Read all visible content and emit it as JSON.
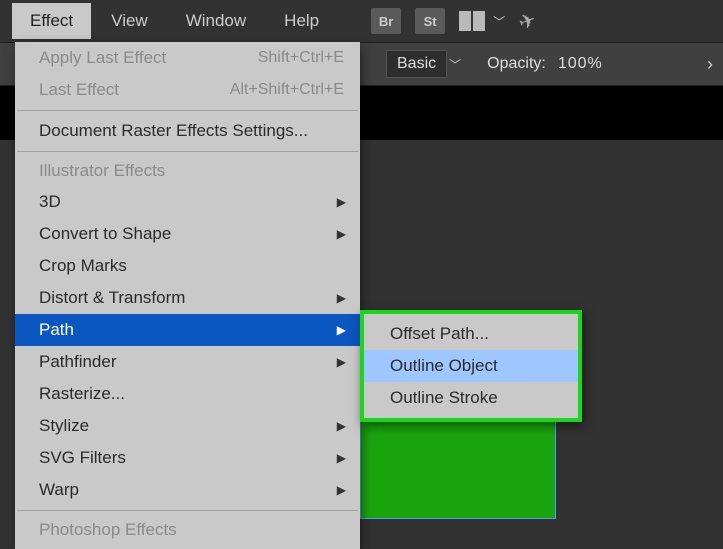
{
  "menubar": {
    "items": [
      "Effect",
      "View",
      "Window",
      "Help"
    ],
    "open_index": 0,
    "icons": {
      "bridge": "Br",
      "stock": "St"
    }
  },
  "optionsbar": {
    "profile": "Basic",
    "opacity_label": "Opacity:",
    "opacity_value": "100%"
  },
  "dropdown": {
    "recent": [
      {
        "label": "Apply Last Effect",
        "shortcut": "Shift+Ctrl+E",
        "disabled": true
      },
      {
        "label": "Last Effect",
        "shortcut": "Alt+Shift+Ctrl+E",
        "disabled": true
      }
    ],
    "doc_settings": "Document Raster Effects Settings...",
    "section1_header": "Illustrator Effects",
    "section1": [
      {
        "label": "3D",
        "sub": true
      },
      {
        "label": "Convert to Shape",
        "sub": true
      },
      {
        "label": "Crop Marks",
        "sub": false
      },
      {
        "label": "Distort & Transform",
        "sub": true
      },
      {
        "label": "Path",
        "sub": true,
        "hov": true
      },
      {
        "label": "Pathfinder",
        "sub": true
      },
      {
        "label": "Rasterize...",
        "sub": false
      },
      {
        "label": "Stylize",
        "sub": true
      },
      {
        "label": "SVG Filters",
        "sub": true
      },
      {
        "label": "Warp",
        "sub": true
      }
    ],
    "section2_header": "Photoshop Effects"
  },
  "submenu": {
    "items": [
      "Offset Path...",
      "Outline Object",
      "Outline Stroke"
    ],
    "selected_index": 1
  }
}
